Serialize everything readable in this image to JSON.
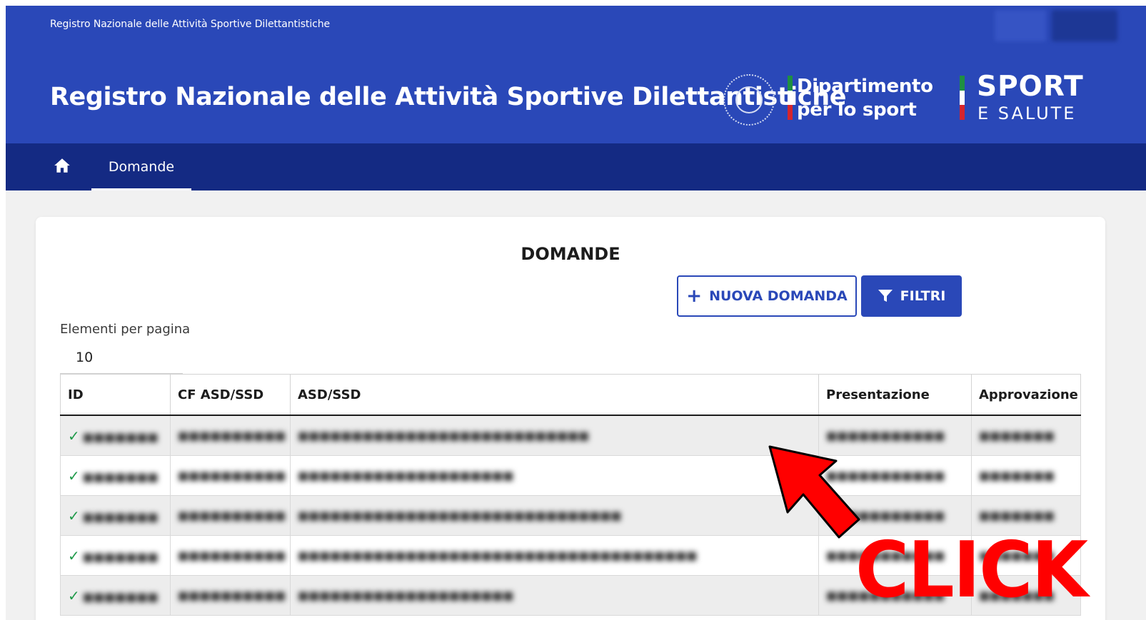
{
  "header": {
    "slim_title": "Registro Nazionale delle Attività Sportive Dilettantistiche",
    "main_title": "Registro Nazionale delle Attività Sportive Dilettantistiche",
    "dept_line1": "Dipartimento",
    "dept_line2": "per lo sport",
    "sport_line1": "SPORT",
    "sport_line2": "E SALUTE"
  },
  "nav": {
    "home_icon": "home-icon",
    "tab_label": "Domande"
  },
  "page": {
    "title": "DOMANDE",
    "new_button": "NUOVA DOMANDA",
    "filter_button": "FILTRI",
    "per_page_label": "Elementi per pagina",
    "per_page_value": "10"
  },
  "table": {
    "columns": [
      "ID",
      "CF ASD/SSD",
      "ASD/SSD",
      "Presentazione",
      "Approvazione"
    ]
  },
  "overlay": {
    "click_text": "CLICK",
    "arrow_color": "#ff0000"
  },
  "colors": {
    "primary": "#2a48b8",
    "navbar": "#142a83",
    "success": "#1f9a4a"
  }
}
